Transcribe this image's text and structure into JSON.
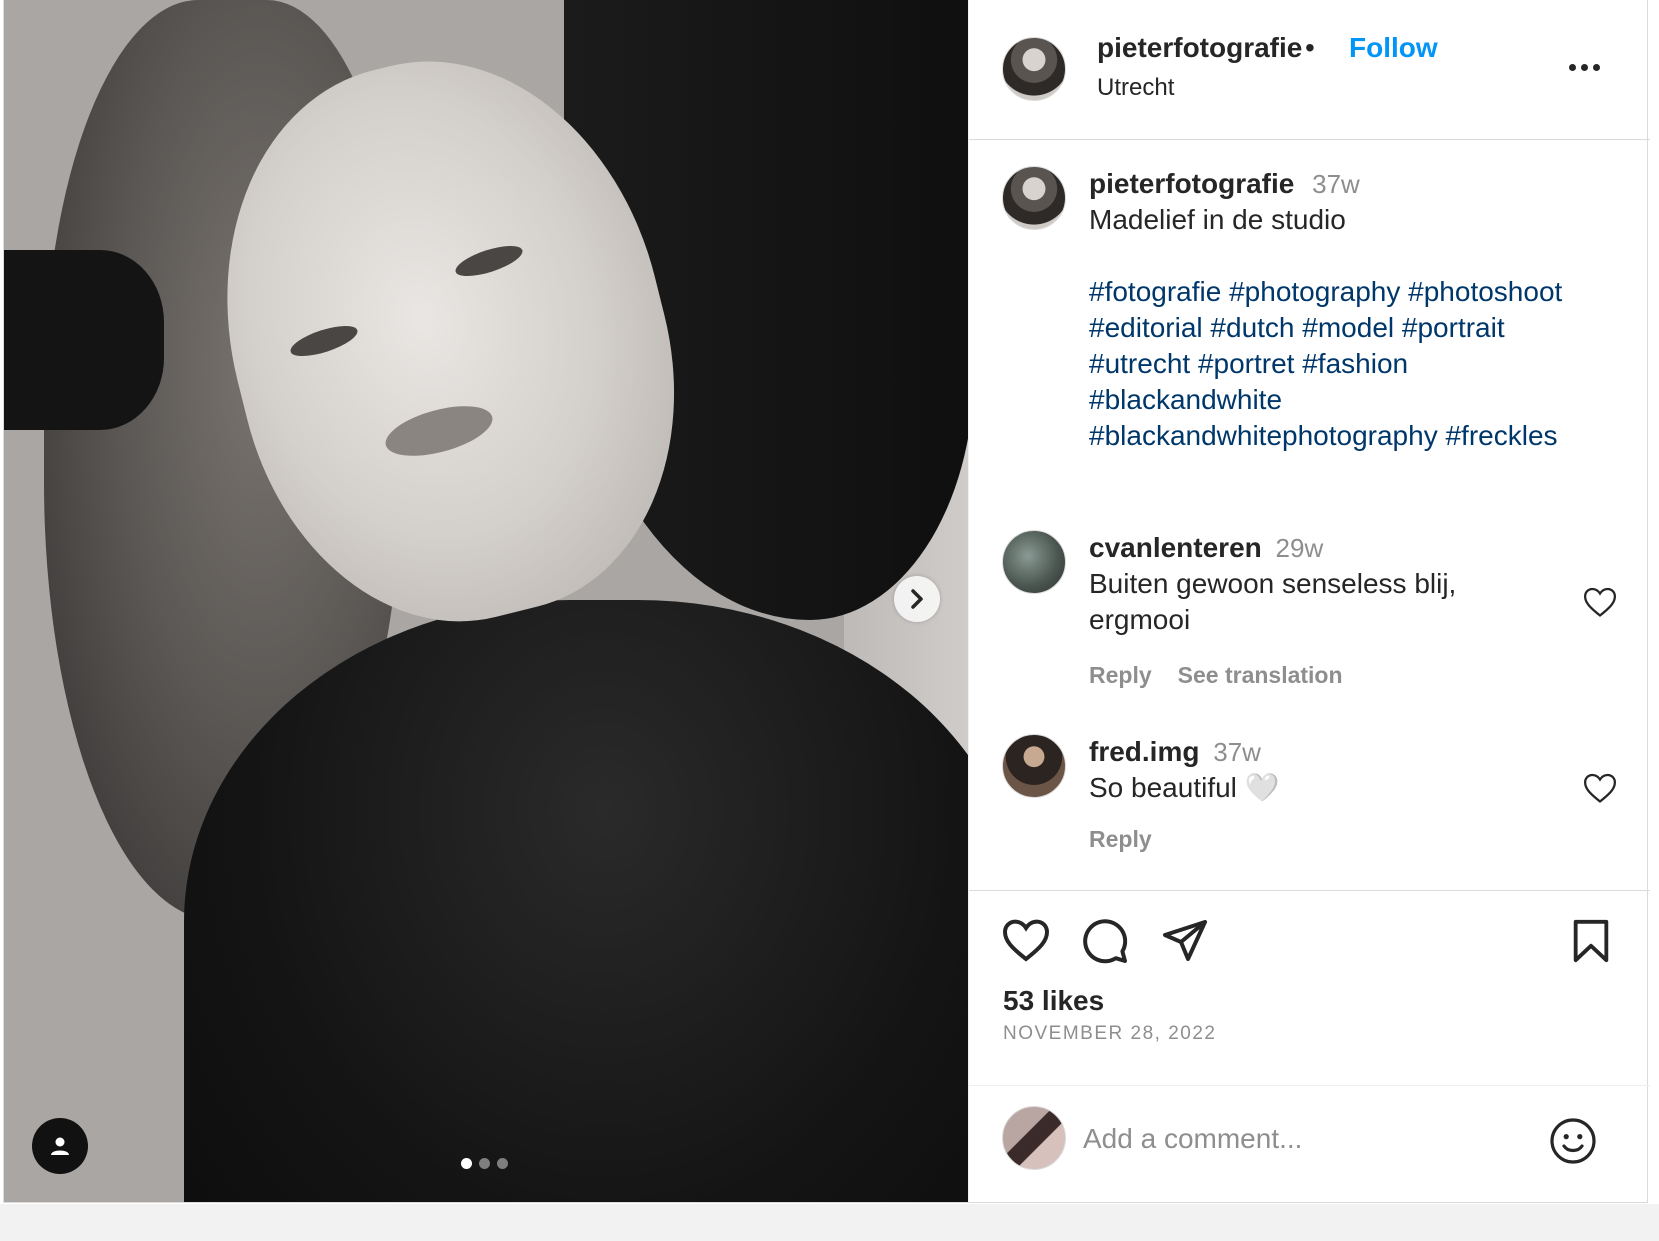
{
  "post": {
    "image_alt": "Black and white portrait photo",
    "carousel": {
      "total": 3,
      "current": 1
    }
  },
  "header": {
    "username": "pieterfotografie",
    "separator": "•",
    "follow_label": "Follow",
    "location": "Utrecht"
  },
  "caption": {
    "username": "pieterfotografie",
    "time": "37w",
    "text": "Madelief in de studio",
    "hashtags": [
      "#fotografie",
      "#photography",
      "#photoshoot",
      "#editorial",
      "#dutch",
      "#model",
      "#portrait",
      "#utrecht",
      "#portret",
      "#fashion",
      "#blackandwhite",
      "#blackandwhitephotography",
      "#freckles"
    ]
  },
  "comments": [
    {
      "username": "cvanlenteren",
      "time": "29w",
      "text": "Buiten gewoon senseless blij, ergmooi",
      "reply_label": "Reply",
      "translate_label": "See translation"
    },
    {
      "username": "fred.img",
      "time": "37w",
      "text": "So beautiful 🤍",
      "reply_label": "Reply"
    }
  ],
  "stats": {
    "likes": "53 likes",
    "date": "NOVEMBER 28, 2022"
  },
  "add_comment": {
    "placeholder": "Add a comment..."
  },
  "icons": {
    "like": "heart-icon",
    "comment": "comment-bubble-icon",
    "share": "paper-plane-icon",
    "save": "bookmark-icon",
    "emoji": "smiley-icon",
    "next": "chevron-right-icon",
    "tags": "user-tag-icon",
    "more": "more-horizontal-icon"
  },
  "colors": {
    "accent": "#0095f6",
    "hashtag": "#00376b",
    "muted": "#8e8e8e",
    "text": "#262626",
    "border": "#dbdbdb"
  }
}
